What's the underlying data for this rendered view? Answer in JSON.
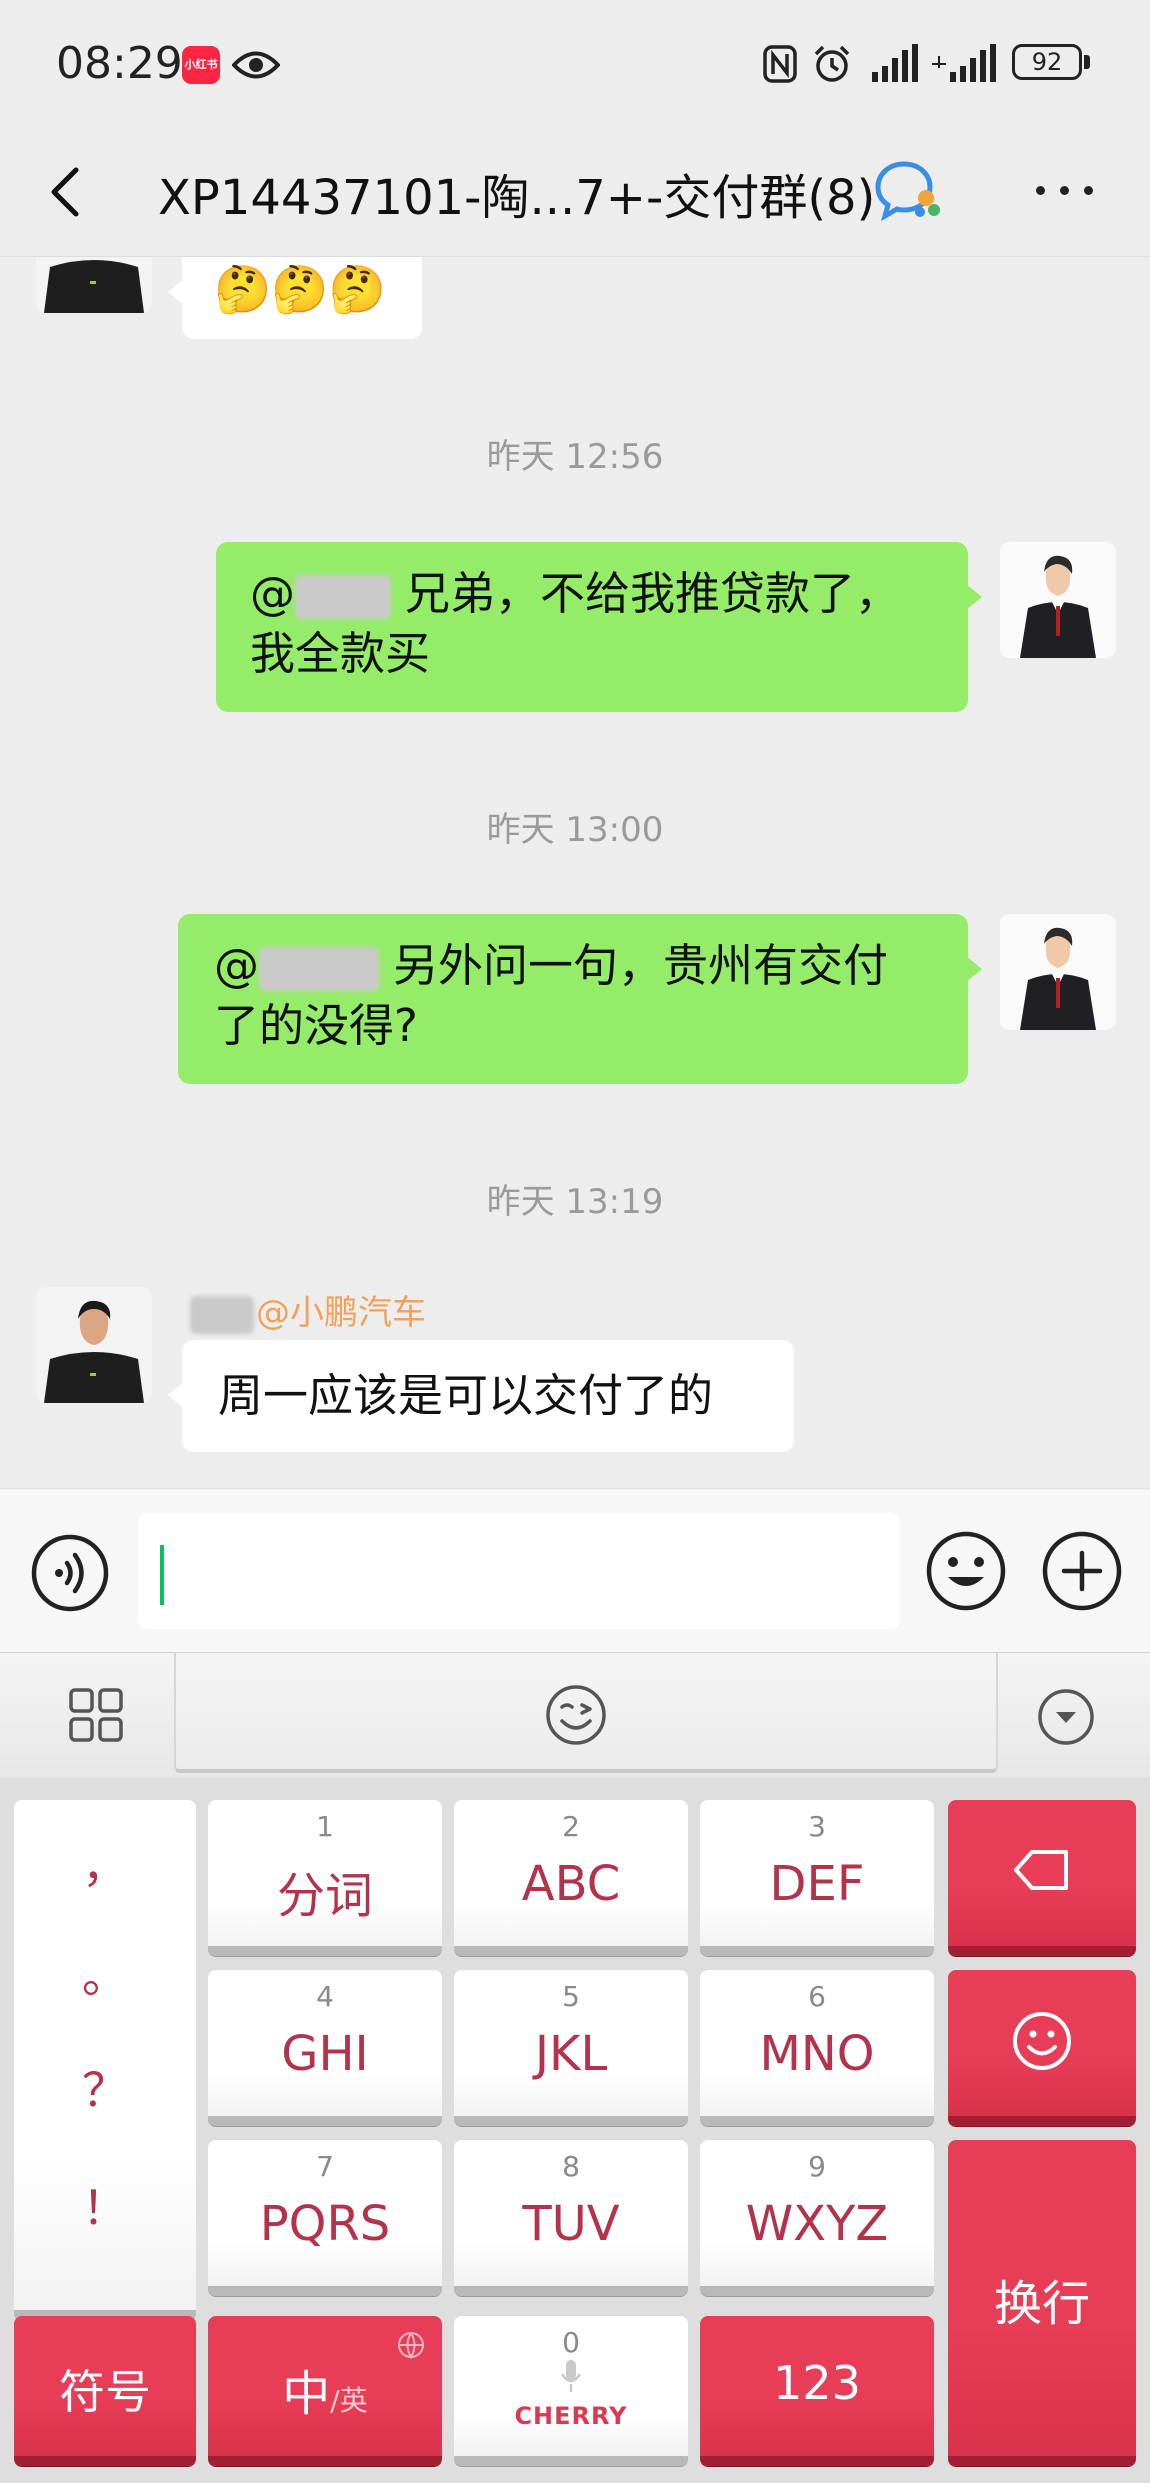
{
  "status_bar": {
    "time": "08:29",
    "app_badge": "小红书",
    "battery": "92"
  },
  "header": {
    "title": "XP14437101-陶...7+-交付群(8)"
  },
  "messages": [
    {
      "side": "in",
      "text": "🤔🤔🤔"
    },
    {
      "type": "timestamp",
      "text": "昨天 12:56"
    },
    {
      "side": "out",
      "mention": "@",
      "text_line1": "兄弟，不给我推贷款了，",
      "text_line2": "我全款买"
    },
    {
      "type": "timestamp",
      "text": "昨天 13:00"
    },
    {
      "side": "out",
      "mention": "@",
      "text_line1": "另外问一句，贵州有交付",
      "text_line2": "了的没得?"
    },
    {
      "type": "timestamp",
      "text": "昨天 13:19"
    },
    {
      "side": "in",
      "sender": "@小鹏汽车",
      "text": "周一应该是可以交付了的"
    }
  ],
  "input": {
    "value": "",
    "placeholder": ""
  },
  "keyboard": {
    "punctuation": [
      "，",
      "。",
      "？",
      "！"
    ],
    "keys": [
      {
        "num": "1",
        "label": "分词"
      },
      {
        "num": "2",
        "label": "ABC"
      },
      {
        "num": "3",
        "label": "DEF"
      },
      {
        "num": "4",
        "label": "GHI"
      },
      {
        "num": "5",
        "label": "JKL"
      },
      {
        "num": "6",
        "label": "MNO"
      },
      {
        "num": "7",
        "label": "PQRS"
      },
      {
        "num": "8",
        "label": "TUV"
      },
      {
        "num": "9",
        "label": "WXYZ"
      }
    ],
    "symbols_label": "符号",
    "lang_main": "中",
    "lang_sub": "/英",
    "space_num": "0",
    "space_brand": "CHERRY",
    "numbers_label": "123",
    "enter_label": "换行"
  },
  "colors": {
    "background": "#ededed",
    "bubble_out": "#95ec69",
    "bubble_in": "#ffffff",
    "key_red": "#e73d56",
    "key_label": "#b2334a",
    "sender_name": "#f0a15a",
    "caret": "#07c160"
  },
  "icons": [
    "eye-icon",
    "nfc-icon",
    "alarm-icon",
    "signal-icon",
    "back-icon",
    "group-chat-icon",
    "more-icon",
    "voice-icon",
    "emoji-icon",
    "plus-icon",
    "grid-icon",
    "collapse-icon",
    "backspace-icon",
    "mic-icon",
    "globe-icon"
  ]
}
